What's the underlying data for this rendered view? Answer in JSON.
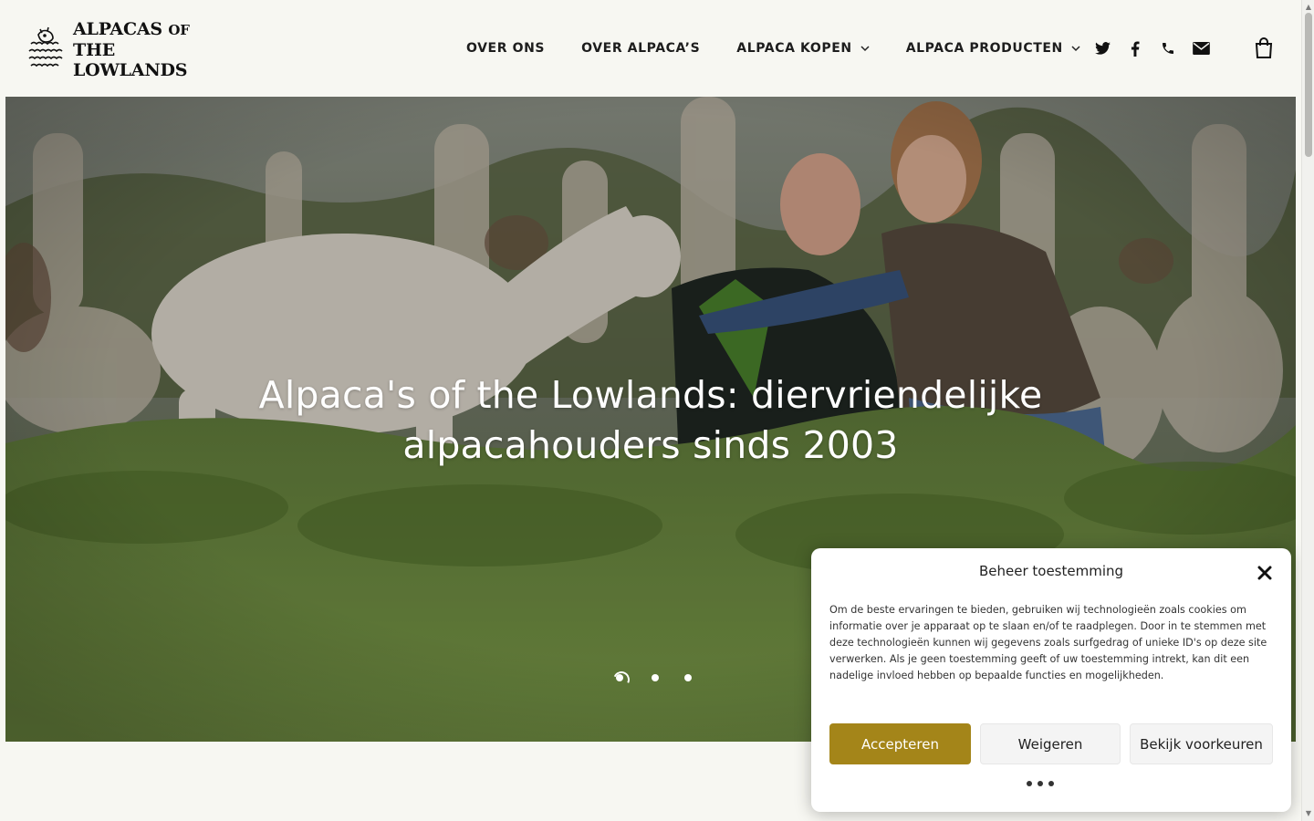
{
  "brand": {
    "line1": "ALPACAS",
    "line1_suffix": "OF",
    "line2": "THE LOWLANDS"
  },
  "nav": {
    "items": [
      {
        "label": "OVER ONS",
        "has_dropdown": false
      },
      {
        "label": "OVER ALPACA’S",
        "has_dropdown": false
      },
      {
        "label": "ALPACA KOPEN",
        "has_dropdown": true
      },
      {
        "label": "ALPACA PRODUCTEN",
        "has_dropdown": true
      }
    ]
  },
  "social": {
    "icons": [
      "twitter-icon",
      "facebook-icon",
      "phone-icon",
      "envelope-icon"
    ],
    "cart_icon": "shopping-bag-icon"
  },
  "hero": {
    "title_line1": "Alpaca's of the Lowlands: diervriendelijke",
    "title_line2": "alpacahouders sinds 2003",
    "slides_total": 3,
    "active_slide": 1
  },
  "consent": {
    "title": "Beheer toestemming",
    "body": "Om de beste ervaringen te bieden, gebruiken wij technologieën zoals cookies om informatie over je apparaat op te slaan en/of te raadplegen. Door in te stemmen met deze technologieën kunnen wij gegevens zoals surfgedrag of unieke ID's op deze site verwerken. Als je geen toestemming geeft of uw toestemming intrekt, kan dit een nadelige invloed hebben op bepaalde functies en mogelijkheden.",
    "accept_label": "Accepteren",
    "deny_label": "Weigeren",
    "prefs_label": "Bekijk voorkeuren"
  },
  "colors": {
    "accent": "#a48519",
    "page_bg": "#f7f7f2"
  }
}
